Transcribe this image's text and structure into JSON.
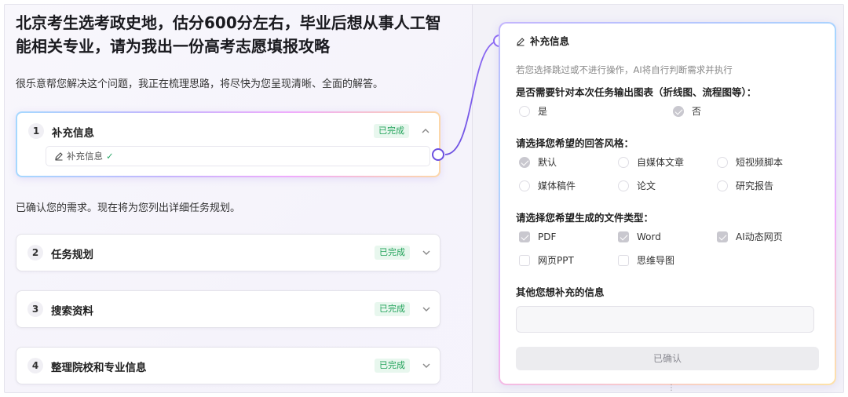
{
  "question": "北京考生选考政史地，估分600分左右，毕业后想从事人工智能相关专业，请为我出一份高考志愿填报攻略",
  "intro": "很乐意帮您解决这个问题，我正在梳理思路，将尽快为您呈现清晰、全面的解答。",
  "confirm_text": "已确认您的需求。现在将为您列出详细任务规划。",
  "steps": [
    {
      "num": "1",
      "title": "补充信息",
      "status": "已完成",
      "sub_label": "补充信息",
      "sub_check": "✓"
    },
    {
      "num": "2",
      "title": "任务规划",
      "status": "已完成"
    },
    {
      "num": "3",
      "title": "搜索资料",
      "status": "已完成"
    },
    {
      "num": "4",
      "title": "整理院校和专业信息",
      "status": "已完成"
    }
  ],
  "panel": {
    "title": "补充信息",
    "note": "若您选择跳过或不进行操作，AI将自行判断需求并执行",
    "q1": {
      "label": "是否需要针对本次任务输出图表（折线图、流程图等）：",
      "options": [
        {
          "label": "是",
          "selected": false
        },
        {
          "label": "否",
          "selected": true
        }
      ]
    },
    "q2": {
      "label": "请选择您希望的回答风格：",
      "options": [
        {
          "label": "默认",
          "selected": true
        },
        {
          "label": "自媒体文章",
          "selected": false
        },
        {
          "label": "短视频脚本",
          "selected": false
        },
        {
          "label": "媒体稿件",
          "selected": false
        },
        {
          "label": "论文",
          "selected": false
        },
        {
          "label": "研究报告",
          "selected": false
        }
      ]
    },
    "q3": {
      "label": "请选择您希望生成的文件类型：",
      "options": [
        {
          "label": "PDF",
          "selected": true
        },
        {
          "label": "Word",
          "selected": true
        },
        {
          "label": "AI动态网页",
          "selected": true
        },
        {
          "label": "网页PPT",
          "selected": false
        },
        {
          "label": "思维导图",
          "selected": false
        }
      ]
    },
    "q4": {
      "label": "其他您想补充的信息",
      "value": "",
      "placeholder": ""
    },
    "confirm_button": "已确认"
  },
  "icons": {
    "edit": "pencil-icon",
    "expand": "chevron-icon"
  },
  "colors": {
    "done_text": "#22a35a",
    "done_bg": "#e8f7ee",
    "accent": "#7c5cf0"
  }
}
